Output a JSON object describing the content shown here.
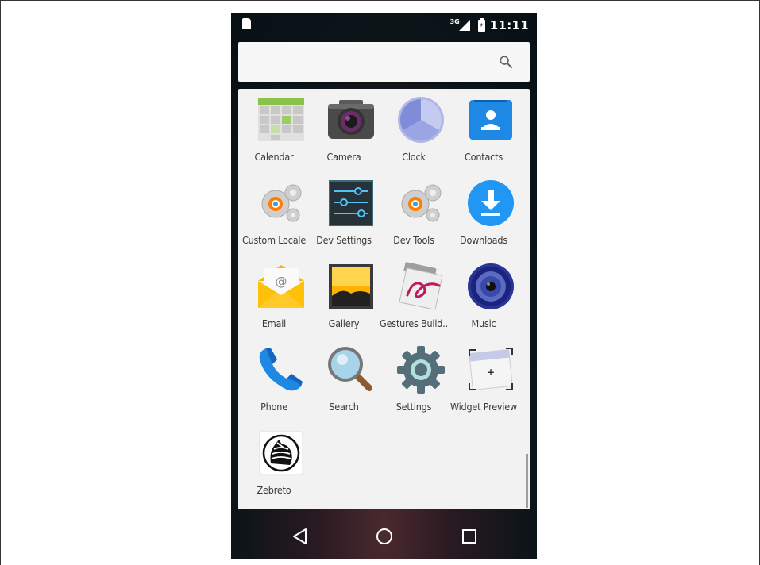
{
  "status_bar": {
    "network_type": "3G",
    "time": "11:11"
  },
  "search_bar": {
    "icon": "search-icon"
  },
  "apps": [
    {
      "label": "Calendar",
      "icon": "calendar-icon"
    },
    {
      "label": "Camera",
      "icon": "camera-icon"
    },
    {
      "label": "Clock",
      "icon": "clock-icon"
    },
    {
      "label": "Contacts",
      "icon": "contacts-icon"
    },
    {
      "label": "Custom Locale",
      "icon": "custom-locale-icon"
    },
    {
      "label": "Dev Settings",
      "icon": "dev-settings-icon"
    },
    {
      "label": "Dev Tools",
      "icon": "dev-tools-icon"
    },
    {
      "label": "Downloads",
      "icon": "downloads-icon"
    },
    {
      "label": "Email",
      "icon": "email-icon"
    },
    {
      "label": "Gallery",
      "icon": "gallery-icon"
    },
    {
      "label": "Gestures Build..",
      "icon": "gestures-builder-icon"
    },
    {
      "label": "Music",
      "icon": "music-icon"
    },
    {
      "label": "Phone",
      "icon": "phone-icon"
    },
    {
      "label": "Search",
      "icon": "magnifier-icon"
    },
    {
      "label": "Settings",
      "icon": "settings-gear-icon"
    },
    {
      "label": "Widget Preview",
      "icon": "widget-preview-icon"
    },
    {
      "label": "Zebreto",
      "icon": "zebra-icon"
    }
  ],
  "nav_bar": {
    "buttons": [
      "back-icon",
      "home-icon",
      "recents-icon"
    ]
  },
  "colors": {
    "drawer_background": "#f2f2f2",
    "label_text": "#3a3a3a",
    "downloads_blue": "#2196f3",
    "contacts_blue": "#1e88e5",
    "clock_purple": "#7f8cd8"
  }
}
